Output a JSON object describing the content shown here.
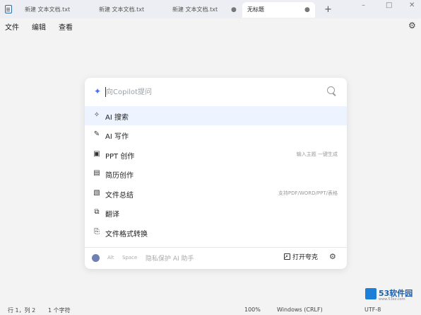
{
  "tabs": [
    {
      "label": "新建 文本文档.txt",
      "active": false
    },
    {
      "label": "新建 文本文档.txt",
      "active": false
    },
    {
      "label": "新建 文本文档.txt",
      "active": false,
      "modified": true
    },
    {
      "label": "无标题",
      "active": true,
      "modified": true
    }
  ],
  "new_tab_label": "+",
  "window_controls": {
    "minimize": "–",
    "maximize": "□",
    "close": "✕"
  },
  "menu": {
    "file": "文件",
    "edit": "编辑",
    "view": "查看"
  },
  "panel": {
    "ask_placeholder": "向Copilot提问",
    "items": [
      {
        "icon": "search-sparkle",
        "label": "AI 搜索",
        "hint": ""
      },
      {
        "icon": "pen",
        "label": "AI 写作",
        "hint": ""
      },
      {
        "icon": "presentation",
        "label": "PPT 创作",
        "hint": "输入主题 一键生成"
      },
      {
        "icon": "resume",
        "label": "简历创作",
        "hint": ""
      },
      {
        "icon": "document-summary",
        "label": "文件总结",
        "hint": "支持PDF/WORD/PPT/表格"
      },
      {
        "icon": "translate",
        "label": "翻译",
        "hint": ""
      },
      {
        "icon": "convert",
        "label": "文件格式转换",
        "hint": ""
      }
    ],
    "footer": {
      "left_a": "Alt",
      "left_b": "Space",
      "main": "隐私保护 AI 助手",
      "open_label": "打开夸克"
    }
  },
  "status": {
    "position": "行 1，列 2",
    "chars": "1 个字符",
    "zoom": "100%",
    "eol": "Windows (CRLF)",
    "encoding": "UTF-8"
  },
  "watermark": {
    "brand": "53软件园",
    "url": "www.53xz.com"
  },
  "colors": {
    "accent": "#4c6ef5",
    "highlight": "#eef4ff",
    "watermark": "#1e7fd8"
  }
}
